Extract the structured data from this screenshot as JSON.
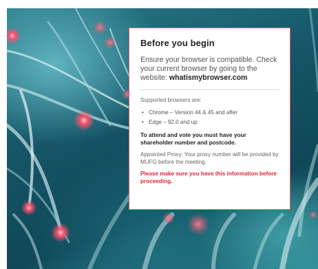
{
  "modal": {
    "title": "Before you begin",
    "intro": "Ensure your browser is compatible. Check your current browser by going to the website:",
    "website": "whatismybrowser.com",
    "supported_label": "Supported browsers are:",
    "browsers": [
      "Chrome – Version 44 & 45 and after",
      "Edge – 92.0 and up"
    ],
    "attend_note": "To attend and vote you must have your shareholder number and postcode.",
    "proxy_note": "Appointed Proxy: Your proxy number will be provided by MUFG before the meeting.",
    "warning": "Please make sure you have this information before proceeding."
  },
  "colors": {
    "warning": "#e0263a",
    "card_border": "#e06070",
    "background_teal": "#155566",
    "glow_pink": "#ff4f6a"
  },
  "icons": {
    "bullet": "bullet-dot-icon"
  },
  "bullet_glyph": "•"
}
